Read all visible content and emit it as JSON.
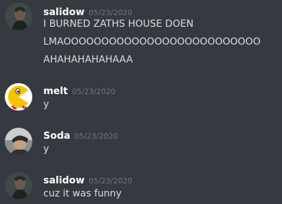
{
  "messages": [
    {
      "author": "salidow",
      "timestamp": "05/23/2020",
      "avatar_icon": "salidow-avatar-icon",
      "lines": [
        "I BURNED ZATHS HOUSE DOEN",
        "LMAOOOOOOOOOOOOOOOOOOOOOOOOOO",
        "AHAHAHAHAHAAA"
      ]
    },
    {
      "author": "melt",
      "timestamp": "05/23/2020",
      "avatar_icon": "pacman-avatar-icon",
      "lines": [
        "y"
      ]
    },
    {
      "author": "Soda",
      "timestamp": "05/23/2020",
      "avatar_icon": "soda-avatar-icon",
      "lines": [
        "y"
      ]
    },
    {
      "author": "salidow",
      "timestamp": "05/23/2020",
      "avatar_icon": "salidow-avatar-icon",
      "lines": [
        "cuz it was funny"
      ]
    }
  ],
  "colors": {
    "background": "#36393f",
    "username": "#ffffff",
    "timestamp": "#72767d",
    "text": "#dcddde"
  }
}
